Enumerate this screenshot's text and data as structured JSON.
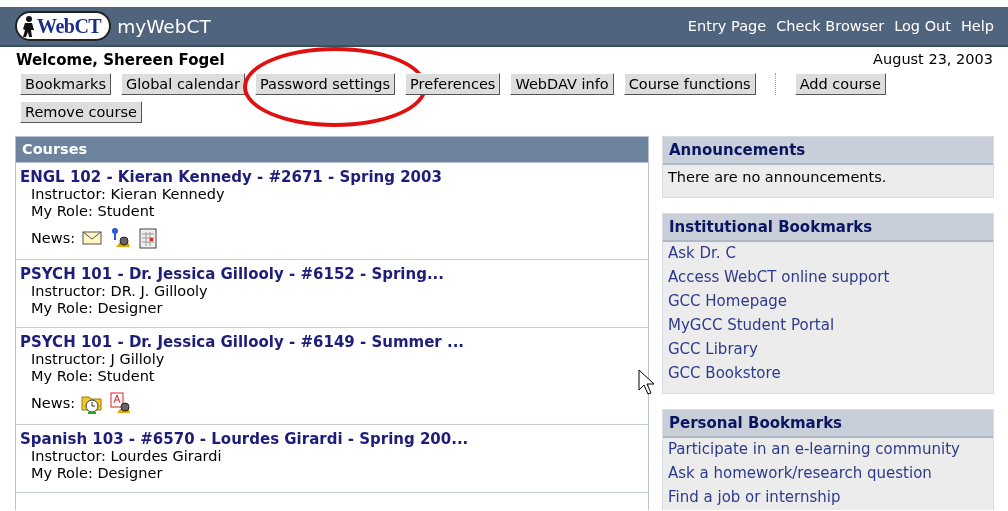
{
  "header": {
    "logo": "WebCT",
    "title": "myWebCT",
    "links": [
      "Entry Page",
      "Check Browser",
      "Log Out",
      "Help"
    ]
  },
  "welcome": "Welcome, Shereen Fogel",
  "date": "August 23, 2003",
  "buttons": [
    {
      "kind": "button",
      "label": "Bookmarks"
    },
    {
      "kind": "button",
      "label": "Global calendar"
    },
    {
      "kind": "button",
      "label": "Password settings",
      "circled": true
    },
    {
      "kind": "button",
      "label": "Preferences"
    },
    {
      "kind": "button",
      "label": "WebDAV info"
    },
    {
      "kind": "button",
      "label": "Course functions"
    },
    {
      "kind": "separator"
    },
    {
      "kind": "button",
      "label": "Add course"
    },
    {
      "kind": "button",
      "label": "Remove course"
    }
  ],
  "courses": {
    "title": "Courses",
    "items": [
      {
        "name": "ENGL 102 - Kieran Kennedy - #2671 - Spring 2003",
        "instructor": "Instructor: Kieran Kennedy",
        "role": "My Role: Student",
        "news_label": "News:",
        "news": [
          {
            "kind": "mail"
          },
          {
            "kind": "pin-search"
          },
          {
            "kind": "calendar"
          }
        ]
      },
      {
        "name": "PSYCH 101 - Dr. Jessica Gillooly - #6152 - Spring...",
        "instructor": "Instructor: DR. J. Gillooly",
        "role": "My Role: Designer"
      },
      {
        "name": "PSYCH 101 - Dr. Jessica Gillooly - #6149 - Summer ...",
        "instructor": "Instructor: J Gilloly",
        "role": "My Role: Student",
        "news_label": "News:",
        "news": [
          {
            "kind": "folder-clock"
          },
          {
            "kind": "doc-search"
          }
        ]
      },
      {
        "name": "Spanish 103 - #6570 - Lourdes Girardi - Spring 200...",
        "instructor": "Instructor: Lourdes Girardi",
        "role": "My Role: Designer"
      }
    ]
  },
  "side_panels": [
    {
      "title": "Announcements",
      "kind": "text",
      "text": "There are no announcements."
    },
    {
      "title": "Institutional Bookmarks",
      "kind": "links",
      "links": [
        "Ask Dr. C",
        "Access WebCT online support",
        "GCC Homepage",
        "MyGCC Student Portal",
        "GCC Library",
        "GCC Bookstore"
      ]
    },
    {
      "title": "Personal Bookmarks",
      "kind": "links",
      "links": [
        "Participate in an e-learning community",
        "Ask a homework/research question",
        "Find a job or internship"
      ]
    }
  ]
}
